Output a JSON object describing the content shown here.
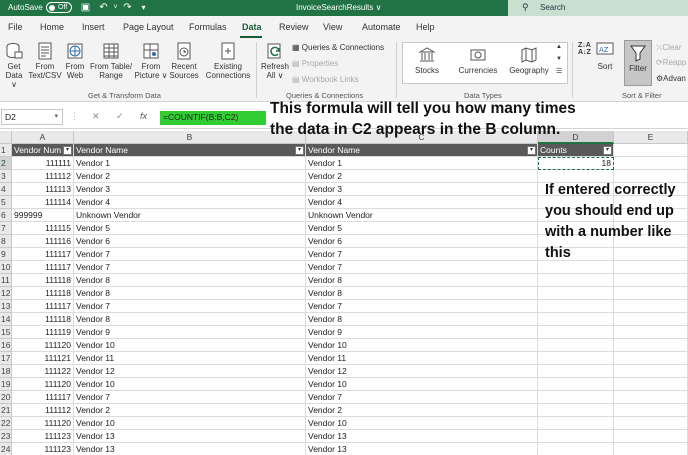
{
  "titlebar": {
    "autosave_label": "AutoSave",
    "autosave_state": "Off",
    "title": "InvoiceSearchResults ∨",
    "search_label": "Search"
  },
  "menu": {
    "tabs": [
      "File",
      "Home",
      "Insert",
      "Page Layout",
      "Formulas",
      "Data",
      "Review",
      "View",
      "Automate",
      "Help"
    ],
    "active": "Data"
  },
  "ribbon": {
    "get_data": "Get\nData ∨",
    "from_text_csv": "From\nText/CSV",
    "from_web": "From\nWeb",
    "from_table_range": "From Table/\nRange",
    "from_picture": "From\nPicture ∨",
    "recent_sources": "Recent\nSources",
    "existing_connections": "Existing\nConnections",
    "group_get_transform": "Get & Transform Data",
    "refresh_all": "Refresh\nAll ∨",
    "queries_connections": "Queries & Connections",
    "properties": "Properties",
    "workbook_links": "Workbook Links",
    "group_queries": "Queries & Connections",
    "stocks": "Stocks",
    "currencies": "Currencies",
    "geography": "Geography",
    "group_data_types": "Data Types",
    "sort_az": "A↓Z",
    "sort": "Sort",
    "filter": "Filter",
    "clear": "Clear",
    "reapply": "Reapp",
    "advanced": "Advan",
    "group_sort_filter": "Sort & Filter"
  },
  "formula_bar": {
    "name_box": "D2",
    "cancel": "✕",
    "enter": "✓",
    "fx": "fx",
    "formula": "=COUNTIF(B:B,C2)"
  },
  "annotations": {
    "formula_note_line1": "This formula will tell you how many times",
    "formula_note_line2": "the data in C2 appears in the B column.",
    "result_note_line1": "If entered correctly",
    "result_note_line2": "you should end up",
    "result_note_line3": "with a number like",
    "result_note_line4": "this"
  },
  "sheet": {
    "columns": [
      "A",
      "B",
      "C",
      "D",
      "E"
    ],
    "headers": {
      "a": "Vendor Num",
      "b": "Vendor Name",
      "c": "Vendor Name",
      "d": "Counts"
    },
    "d2_value": "18",
    "rows": [
      {
        "r": "1"
      },
      {
        "r": "2",
        "a": "111111",
        "b": "Vendor 1",
        "c": "Vendor 1"
      },
      {
        "r": "3",
        "a": "111112",
        "b": "Vendor 2",
        "c": "Vendor 2"
      },
      {
        "r": "4",
        "a": "111113",
        "b": "Vendor 3",
        "c": "Vendor 3"
      },
      {
        "r": "5",
        "a": "111114",
        "b": "Vendor 4",
        "c": "Vendor 4"
      },
      {
        "r": "6",
        "a": "999999",
        "b": "Unknown Vendor",
        "c": "Unknown Vendor",
        "a_left": true
      },
      {
        "r": "7",
        "a": "111115",
        "b": "Vendor 5",
        "c": "Vendor 5"
      },
      {
        "r": "8",
        "a": "111116",
        "b": "Vendor 6",
        "c": "Vendor 6"
      },
      {
        "r": "9",
        "a": "111117",
        "b": "Vendor 7",
        "c": "Vendor 7"
      },
      {
        "r": "10",
        "a": "111117",
        "b": "Vendor 7",
        "c": "Vendor 7"
      },
      {
        "r": "11",
        "a": "111118",
        "b": "Vendor 8",
        "c": "Vendor 8"
      },
      {
        "r": "12",
        "a": "111118",
        "b": "Vendor 8",
        "c": "Vendor 8"
      },
      {
        "r": "13",
        "a": "111117",
        "b": "Vendor 7",
        "c": "Vendor 7"
      },
      {
        "r": "14",
        "a": "111118",
        "b": "Vendor 8",
        "c": "Vendor 8"
      },
      {
        "r": "15",
        "a": "111119",
        "b": "Vendor 9",
        "c": "Vendor 9"
      },
      {
        "r": "16",
        "a": "111120",
        "b": "Vendor 10",
        "c": "Vendor 10"
      },
      {
        "r": "17",
        "a": "111121",
        "b": "Vendor 11",
        "c": "Vendor 11"
      },
      {
        "r": "18",
        "a": "111122",
        "b": "Vendor 12",
        "c": "Vendor 12"
      },
      {
        "r": "19",
        "a": "111120",
        "b": "Vendor 10",
        "c": "Vendor 10"
      },
      {
        "r": "20",
        "a": "111117",
        "b": "Vendor 7",
        "c": "Vendor 7"
      },
      {
        "r": "21",
        "a": "111112",
        "b": "Vendor 2",
        "c": "Vendor 2"
      },
      {
        "r": "22",
        "a": "111120",
        "b": "Vendor 10",
        "c": "Vendor 10"
      },
      {
        "r": "23",
        "a": "111123",
        "b": "Vendor 13",
        "c": "Vendor 13"
      },
      {
        "r": "24",
        "a": "111123",
        "b": "Vendor 13",
        "c": "Vendor 13"
      }
    ]
  },
  "colors": {
    "excel_green": "#217346",
    "formula_highlight": "#32cd32",
    "header_fill": "#595959"
  }
}
